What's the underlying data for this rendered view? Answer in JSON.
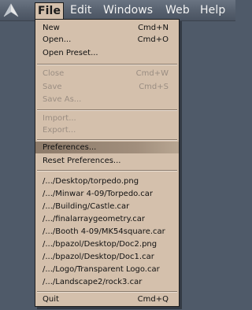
{
  "menubar": {
    "logo_icon": "app-logo-icon",
    "titles": [
      "File",
      "Edit",
      "Windows",
      "Web",
      "Help"
    ]
  },
  "file_menu": {
    "new": {
      "label": "New",
      "shortcut": "Cmd+N"
    },
    "open": {
      "label": "Open...",
      "shortcut": "Cmd+O"
    },
    "open_preset": {
      "label": "Open Preset..."
    },
    "close": {
      "label": "Close",
      "shortcut": "Cmd+W"
    },
    "save": {
      "label": "Save",
      "shortcut": "Cmd+S"
    },
    "save_as": {
      "label": "Save As..."
    },
    "import": {
      "label": "Import..."
    },
    "export": {
      "label": "Export..."
    },
    "preferences": {
      "label": "Preferences..."
    },
    "reset_preferences": {
      "label": "Reset Preferences..."
    },
    "recent_files": [
      "/.../Desktop/torpedo.png",
      "/.../Minwar 4-09/Torpedo.car",
      "/.../Building/Castle.car",
      "/.../finalarraygeometry.car",
      "/.../Booth 4-09/MK54square.car",
      "/.../bpazol/Desktop/Doc2.png",
      "/.../bpazol/Desktop/Doc1.car",
      "/.../Logo/Transparent Logo.car",
      "/.../Landscape2/rock3.car"
    ],
    "quit": {
      "label": "Quit",
      "shortcut": "Cmd+Q"
    }
  },
  "colors": {
    "menu_bg": "#d4c0ac",
    "highlight": "#a18e7c",
    "disabled_text": "#9a8d82",
    "menubar_bg": "#5a6472"
  }
}
